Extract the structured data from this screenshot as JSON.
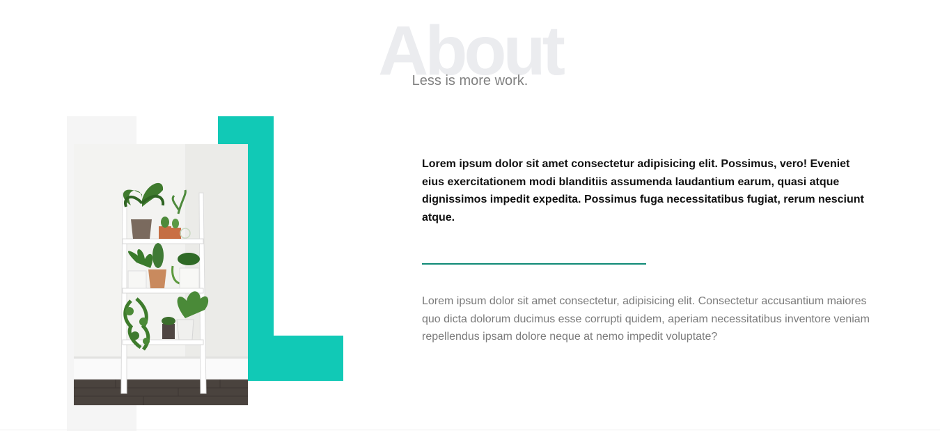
{
  "section": {
    "background_title": "About",
    "subtitle": "Less is more work."
  },
  "about": {
    "lead_paragraph": "Lorem ipsum dolor sit amet consectetur adipisicing elit. Possimus, vero! Eveniet eius exercitationem modi blanditiis assumenda laudantium earum, quasi atque dignissimos impedit expedita. Possimus fuga necessitatibus fugiat, rerum nesciunt atque.",
    "body_paragraph": "Lorem ipsum dolor sit amet consectetur, adipisicing elit. Consectetur accusantium maiores quo dicta dolorum ducimus esse corrupti quidem, aperiam necessitatibus inventore veniam repellendus ipsam dolore neque at nemo impedit voluptate?"
  },
  "colors": {
    "accent": "#11c9b6",
    "divider": "#0f8a76",
    "title_watermark": "#ebecef",
    "muted_text": "#7a7a7a"
  }
}
